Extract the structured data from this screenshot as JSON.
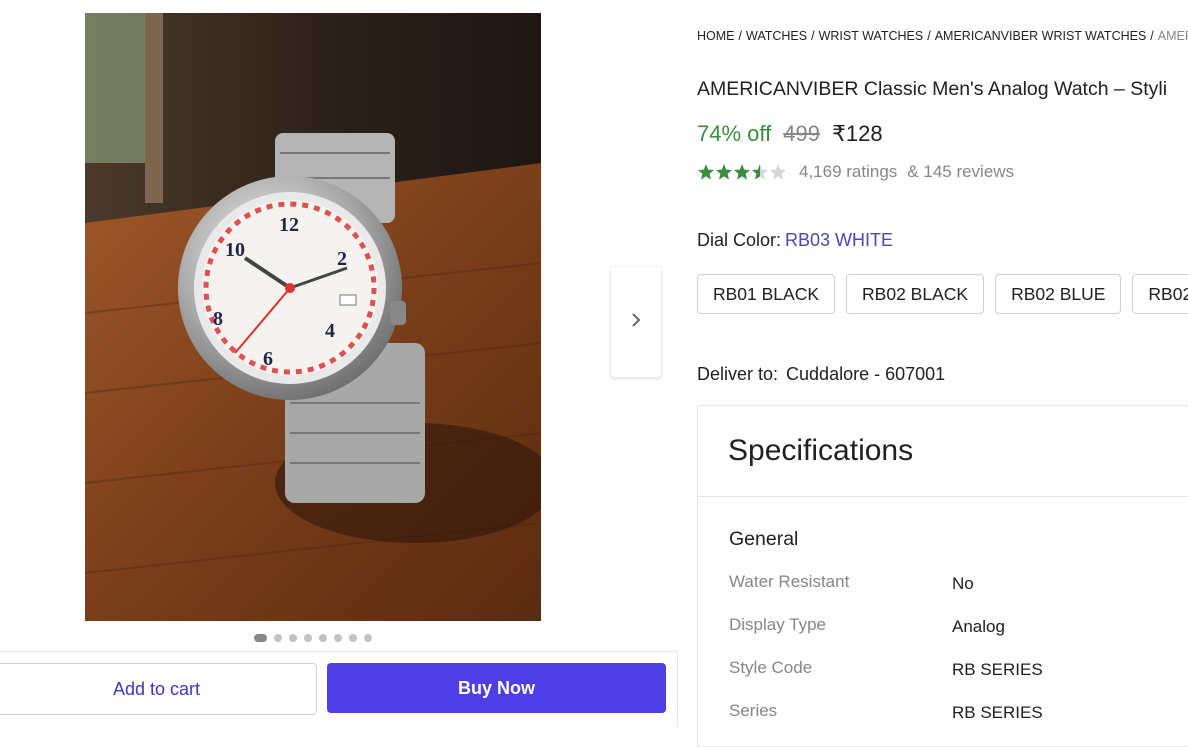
{
  "gallery": {
    "image_alt": "Silver analog wrist watch with white dial on a wooden table",
    "dot_count": 8,
    "active_dot": 0
  },
  "actions": {
    "add_to_cart": "Add to cart",
    "buy_now": "Buy Now"
  },
  "breadcrumbs": [
    "HOME",
    "WATCHES",
    "WRIST WATCHES",
    "AMERICANVIBER WRIST WATCHES",
    "AMER"
  ],
  "product": {
    "title": "AMERICANVIBER Classic Men's Analog Watch – Styli",
    "discount": "74% off",
    "mrp": "499",
    "price": "₹128",
    "rating_value": 3.5,
    "ratings": "4,169 ratings",
    "reviews": "& 145 reviews"
  },
  "dial": {
    "label": "Dial Color:",
    "value": "RB03 WHITE",
    "options": [
      "RB01 BLACK",
      "RB02 BLACK",
      "RB02 BLUE",
      "RB02"
    ]
  },
  "delivery": {
    "label": "Deliver to:",
    "location": "Cuddalore - 607001"
  },
  "specifications": {
    "title": "Specifications",
    "group": "General",
    "rows": [
      {
        "key": "Water Resistant",
        "value": "No"
      },
      {
        "key": "Display Type",
        "value": "Analog"
      },
      {
        "key": "Style Code",
        "value": "RB SERIES"
      },
      {
        "key": "Series",
        "value": "RB SERIES"
      }
    ]
  },
  "colors": {
    "accent": "#4f3de6",
    "accent_text": "#3d35c4",
    "discount_green": "#388e3c",
    "star_green": "#388e3c",
    "muted": "#878787"
  },
  "icons": {
    "next": "chevron-right-icon",
    "star": "star-icon"
  }
}
